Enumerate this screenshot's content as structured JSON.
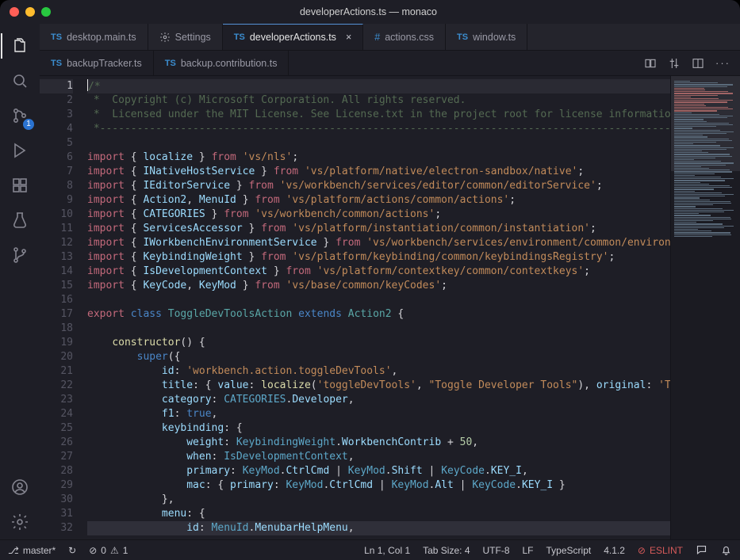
{
  "titlebar": {
    "title": "developerActions.ts — monaco"
  },
  "activitybar": {
    "explorer": "Explorer",
    "search": "Search",
    "scm": "Source Control",
    "scm_badge": "1",
    "run": "Run",
    "ext": "Extensions",
    "test": "Testing",
    "branches": "Branches",
    "account": "Accounts",
    "settings": "Manage"
  },
  "tabs_row1": [
    {
      "icon": "ts",
      "label": "desktop.main.ts"
    },
    {
      "icon": "gear",
      "label": "Settings"
    },
    {
      "icon": "ts",
      "label": "developerActions.ts",
      "active": true,
      "close": "×"
    },
    {
      "icon": "css",
      "label": "actions.css"
    },
    {
      "icon": "ts",
      "label": "window.ts"
    }
  ],
  "tabs_row2": [
    {
      "icon": "ts",
      "label": "backupTracker.ts"
    },
    {
      "icon": "ts",
      "label": "backup.contribution.ts"
    }
  ],
  "tabactions": {
    "diff": "Compare",
    "changes": "Open Changes",
    "split": "Split Editor",
    "more": "More"
  },
  "code_lines": [
    {
      "n": 1,
      "html": "<span class='caret'></span><span class='c-comment'>/*</span>",
      "current": true
    },
    {
      "n": 2,
      "html": "<span class='c-comment'> *  Copyright (c) Microsoft Corporation. All rights reserved.</span>"
    },
    {
      "n": 3,
      "html": "<span class='c-comment'> *  Licensed under the MIT License. See License.txt in the project root for license information.</span>"
    },
    {
      "n": 4,
      "html": "<span class='c-comment'> *--------------------------------------------------------------------------------------------*/</span>"
    },
    {
      "n": 5,
      "html": ""
    },
    {
      "n": 6,
      "html": "<span class='c-key'>import</span> { <span class='c-prop'>localize</span> } <span class='c-key'>from</span> <span class='c-str'>'vs/nls'</span>;"
    },
    {
      "n": 7,
      "html": "<span class='c-key'>import</span> { <span class='c-prop'>INativeHostService</span> } <span class='c-key'>from</span> <span class='c-str'>'vs/platform/native/electron-sandbox/native'</span>;"
    },
    {
      "n": 8,
      "html": "<span class='c-key'>import</span> { <span class='c-prop'>IEditorService</span> } <span class='c-key'>from</span> <span class='c-str'>'vs/workbench/services/editor/common/editorService'</span>;"
    },
    {
      "n": 9,
      "html": "<span class='c-key'>import</span> { <span class='c-prop'>Action2</span>, <span class='c-prop'>MenuId</span> } <span class='c-key'>from</span> <span class='c-str'>'vs/platform/actions/common/actions'</span>;"
    },
    {
      "n": 10,
      "html": "<span class='c-key'>import</span> { <span class='c-prop'>CATEGORIES</span> } <span class='c-key'>from</span> <span class='c-str'>'vs/workbench/common/actions'</span>;"
    },
    {
      "n": 11,
      "html": "<span class='c-key'>import</span> { <span class='c-prop'>ServicesAccessor</span> } <span class='c-key'>from</span> <span class='c-str'>'vs/platform/instantiation/common/instantiation'</span>;"
    },
    {
      "n": 12,
      "html": "<span class='c-key'>import</span> { <span class='c-prop'>IWorkbenchEnvironmentService</span> } <span class='c-key'>from</span> <span class='c-str'>'vs/workbench/services/environment/common/environme</span>"
    },
    {
      "n": 13,
      "html": "<span class='c-key'>import</span> { <span class='c-prop'>KeybindingWeight</span> } <span class='c-key'>from</span> <span class='c-str'>'vs/platform/keybinding/common/keybindingsRegistry'</span>;"
    },
    {
      "n": 14,
      "html": "<span class='c-key'>import</span> { <span class='c-prop'>IsDevelopmentContext</span> } <span class='c-key'>from</span> <span class='c-str'>'vs/platform/contextkey/common/contextkeys'</span>;"
    },
    {
      "n": 15,
      "html": "<span class='c-key'>import</span> { <span class='c-prop'>KeyCode</span>, <span class='c-prop'>KeyMod</span> } <span class='c-key'>from</span> <span class='c-str'>'vs/base/common/keyCodes'</span>;"
    },
    {
      "n": 16,
      "html": ""
    },
    {
      "n": 17,
      "html": "<span class='c-key'>export</span> <span class='c-blue'>class</span> <span class='c-type'>ToggleDevToolsAction</span> <span class='c-blue'>extends</span> <span class='c-type'>Action2</span> {"
    },
    {
      "n": 18,
      "html": ""
    },
    {
      "n": 19,
      "html": "    <span class='c-fn'>constructor</span>() {"
    },
    {
      "n": 20,
      "html": "        <span class='c-blue'>super</span>({"
    },
    {
      "n": 21,
      "html": "            <span class='c-prop'>id</span>: <span class='c-str'>'workbench.action.toggleDevTools'</span>,"
    },
    {
      "n": 22,
      "html": "            <span class='c-prop'>title</span>: { <span class='c-prop'>value</span>: <span class='c-fn'>localize</span>(<span class='c-str'>'toggleDevTools'</span>, <span class='c-str'>\"Toggle Developer Tools\"</span>), <span class='c-prop'>original</span>: <span class='c-str'>'Tog</span>"
    },
    {
      "n": 23,
      "html": "            <span class='c-prop'>category</span>: <span class='c-const'>CATEGORIES</span>.<span class='c-prop'>Developer</span>,"
    },
    {
      "n": 24,
      "html": "            <span class='c-prop'>f1</span>: <span class='c-blue'>true</span>,"
    },
    {
      "n": 25,
      "html": "            <span class='c-prop'>keybinding</span>: {"
    },
    {
      "n": 26,
      "html": "                <span class='c-prop'>weight</span>: <span class='c-const'>KeybindingWeight</span>.<span class='c-prop'>WorkbenchContrib</span> + <span class='c-num'>50</span>,"
    },
    {
      "n": 27,
      "html": "                <span class='c-prop'>when</span>: <span class='c-const'>IsDevelopmentContext</span>,"
    },
    {
      "n": 28,
      "html": "                <span class='c-prop'>primary</span>: <span class='c-const'>KeyMod</span>.<span class='c-prop'>CtrlCmd</span> | <span class='c-const'>KeyMod</span>.<span class='c-prop'>Shift</span> | <span class='c-const'>KeyCode</span>.<span class='c-prop'>KEY_I</span>,"
    },
    {
      "n": 29,
      "html": "                <span class='c-prop'>mac</span>: { <span class='c-prop'>primary</span>: <span class='c-const'>KeyMod</span>.<span class='c-prop'>CtrlCmd</span> | <span class='c-const'>KeyMod</span>.<span class='c-prop'>Alt</span> | <span class='c-const'>KeyCode</span>.<span class='c-prop'>KEY_I</span> }"
    },
    {
      "n": 30,
      "html": "            },"
    },
    {
      "n": 31,
      "html": "            <span class='c-prop'>menu</span>: {"
    },
    {
      "n": 32,
      "html": "                <span class='c-prop'>id</span>: <span class='c-const'>MenuId</span>.<span class='c-prop'>MenubarHelpMenu</span>,",
      "hl": true
    }
  ],
  "status": {
    "branch_icon": "⎇",
    "branch": "master*",
    "sync_icon": "↻",
    "errors_icon": "⊘",
    "errors": "0",
    "warnings_icon": "⚠",
    "warnings": "1",
    "cursor": "Ln 1, Col 1",
    "tabsize": "Tab Size: 4",
    "encoding": "UTF-8",
    "eol": "LF",
    "lang": "TypeScript",
    "ver": "4.1.2",
    "eslint_icon": "⊘",
    "eslint": "ESLINT",
    "feedback_icon": "⊕",
    "bell_icon": "🔔"
  }
}
